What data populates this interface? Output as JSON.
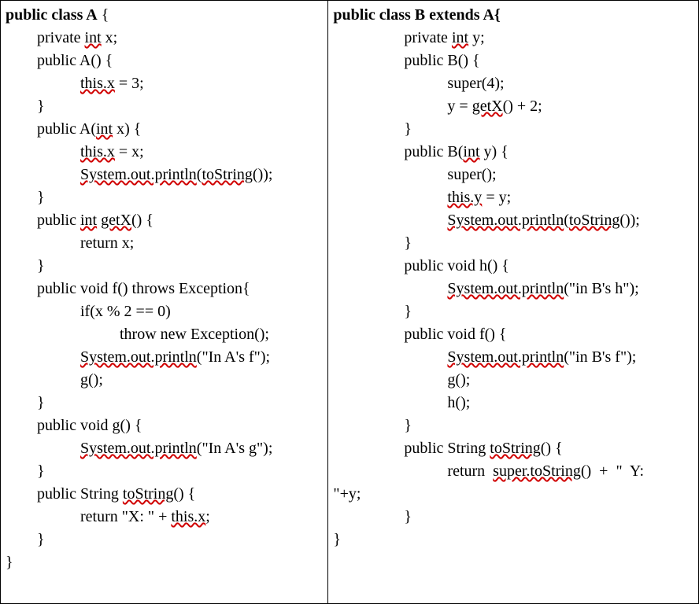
{
  "classA": {
    "l1_public_class": "public class",
    "l1_A": " A",
    "l1_brace": " {",
    "l2_indent_private": "        private ",
    "l2_int": "int",
    "l2_x": " x;",
    "l3_public_A": "        public A() {",
    "l4_indent": "                   ",
    "l4_thisx": "this.x",
    "l4_eq3": " = 3;",
    "l5_close": "        }",
    "l6_public_A_open": "        public A(",
    "l6_int": "int",
    "l6_x_close": " x) {",
    "l7_indent": "                   ",
    "l7_thisx": "this.x",
    "l7_eqx": " = x;",
    "l8_indent": "                   ",
    "l8_sop": "System.out.println",
    "l8_open": "(",
    "l8_ts": "toString",
    "l8_close": "());",
    "l9_close": "        }",
    "l10_public": "        public ",
    "l10_int": "int",
    "l10_sp": " ",
    "l10_getx": "getX",
    "l10_paren": "() {",
    "l11_return_x": "                   return x;",
    "l12_close": "        }",
    "l13_throws": "        public void f() throws Exception{",
    "l14_if": "                   if(x % 2 == 0)",
    "l15_throw": "                             throw new Exception();",
    "l16_indent": "                   ",
    "l16_sop": "System.out.println",
    "l16_args": "(\"In A's f\");",
    "l17_blank": "",
    "l18_g": "                   g();",
    "l19_close": "        }",
    "l20_gdecl": "        public void g() {",
    "l21_indent": "                   ",
    "l21_sop": "System.out.println",
    "l21_args": "(\"In A's g\");",
    "l22_blank": "",
    "l23_close": "        }",
    "l24_ts_pre": "        public String ",
    "l24_ts": "toString",
    "l24_paren": "() {",
    "l25_return_pre": "                   return \"X: \" + ",
    "l25_thisx": "this.x",
    "l25_semi": ";",
    "l26_close": "        }",
    "l27_close": "}"
  },
  "classB": {
    "l1_public_class": "public class",
    "l1_B": " B ",
    "l1_extends": "extends",
    "l1_A_brace": " A{",
    "l2_indent_private": "                  private ",
    "l2_int": "int",
    "l2_y": " y;",
    "l3_public_B": "                  public B() {",
    "l4_super4": "                             super(4);",
    "l5_indent": "                             y = ",
    "l5_getx": "getX",
    "l5_plus2": "() + 2;",
    "l6_close": "                  }",
    "l7_public_B_open": "                  public B(",
    "l7_int": "int",
    "l7_y_close": " y) {",
    "l8_super": "                             super();",
    "l9_indent": "                             ",
    "l9_thisy": "this.y",
    "l9_eqy": " = y;",
    "l10_indent": "                             ",
    "l10_sop": "System.out.println",
    "l10_open": "(",
    "l10_ts": "toString",
    "l10_close": "());",
    "l11_close": "                  }",
    "l12_hdecl": "                  public void h() {",
    "l13_indent": "                             ",
    "l13_sop": "System.out.println",
    "l13_args": "(\"in B's h\");",
    "l14_close": "                  }",
    "l15_fdecl": "                  public void f() {",
    "l16_indent": "                             ",
    "l16_sop": "System.out.println",
    "l16_args": "(\"in B's f\");",
    "l17_g": "                             g();",
    "l18_h": "                             h();",
    "l19_close": "                  }",
    "l20_ts_pre": "                  public String ",
    "l20_ts": "toString",
    "l20_paren": "() {",
    "l21_return_pre": "                             return  ",
    "l21_super_ts": "super.toString",
    "l21_tail": "()  +  \"  Y:",
    "l22_wrap": "\"+y;",
    "l23_close": "                  }",
    "l24_close": "}"
  }
}
